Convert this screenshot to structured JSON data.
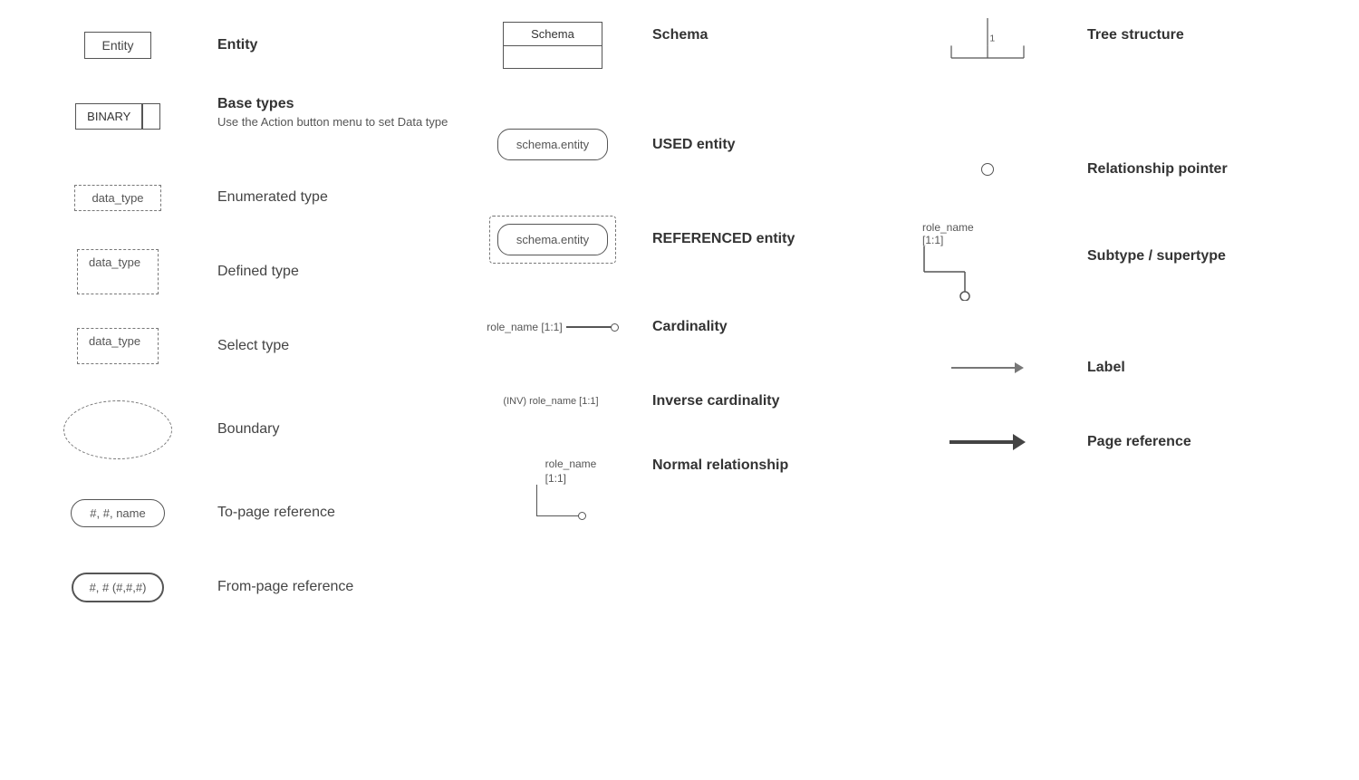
{
  "col1": {
    "rows": [
      {
        "id": "entity",
        "symbol_type": "entity-box",
        "symbol_text": "Entity",
        "label": "Entity",
        "bold": true
      },
      {
        "id": "base-types",
        "symbol_type": "base-type-box",
        "symbol_text": "BINARY",
        "label": "Base types",
        "bold": true,
        "sublabel": "Use the Action button menu to set Data type"
      },
      {
        "id": "enumerated",
        "symbol_type": "dashed-box",
        "symbol_text": "data_type",
        "label": "Enumerated type",
        "bold": false
      },
      {
        "id": "defined",
        "symbol_type": "dashed-box-large",
        "symbol_text": "data_type",
        "label": "Defined type",
        "bold": false
      },
      {
        "id": "select",
        "symbol_type": "dashed-box-large",
        "symbol_text": "data_type",
        "label": "Select type",
        "bold": false
      },
      {
        "id": "boundary",
        "symbol_type": "ellipse",
        "label": "Boundary",
        "bold": false
      },
      {
        "id": "to-page",
        "symbol_type": "pill",
        "symbol_text": "#, #, name",
        "label": "To-page reference",
        "bold": false
      },
      {
        "id": "from-page",
        "symbol_type": "pill-thick",
        "symbol_text": "#, # (#,#,#)",
        "label": "From-page reference",
        "bold": false
      }
    ]
  },
  "col2": {
    "rows": [
      {
        "id": "schema",
        "symbol_type": "schema-box",
        "symbol_text": "Schema",
        "label": "Schema",
        "bold": true
      },
      {
        "id": "used-entity",
        "symbol_type": "used-entity",
        "symbol_text": "schema.entity",
        "label": "USED entity",
        "bold": true
      },
      {
        "id": "referenced-entity",
        "symbol_type": "ref-entity",
        "symbol_text": "schema.entity",
        "label": "REFERENCED entity",
        "bold": true
      },
      {
        "id": "cardinality",
        "symbol_type": "cardinality",
        "card_text": "role_name [1:1]",
        "label": "Cardinality",
        "bold": true
      },
      {
        "id": "inv-cardinality",
        "symbol_type": "inv-cardinality",
        "card_text": "(INV) role_name [1:1]",
        "label": "Inverse cardinality",
        "bold": true
      },
      {
        "id": "normal-rel",
        "symbol_type": "normal-rel",
        "role_label": "role_name",
        "card_label": "[1:1]",
        "label": "Normal relationship",
        "bold": true
      }
    ]
  },
  "col3": {
    "rows": [
      {
        "id": "tree-structure",
        "symbol_type": "tree",
        "label": "Tree structure",
        "bold": true
      },
      {
        "id": "rel-pointer",
        "symbol_type": "rel-pointer",
        "label": "Relationship pointer",
        "bold": true
      },
      {
        "id": "subtype",
        "symbol_type": "subtype",
        "role_text": "role_name",
        "card_text": "[1:1]",
        "label": "Subtype / supertype",
        "bold": true
      },
      {
        "id": "label-arrow",
        "symbol_type": "label-arrow",
        "label": "Label",
        "bold": true
      },
      {
        "id": "page-ref",
        "symbol_type": "page-ref-arrow",
        "label": "Page reference",
        "bold": true
      }
    ]
  }
}
